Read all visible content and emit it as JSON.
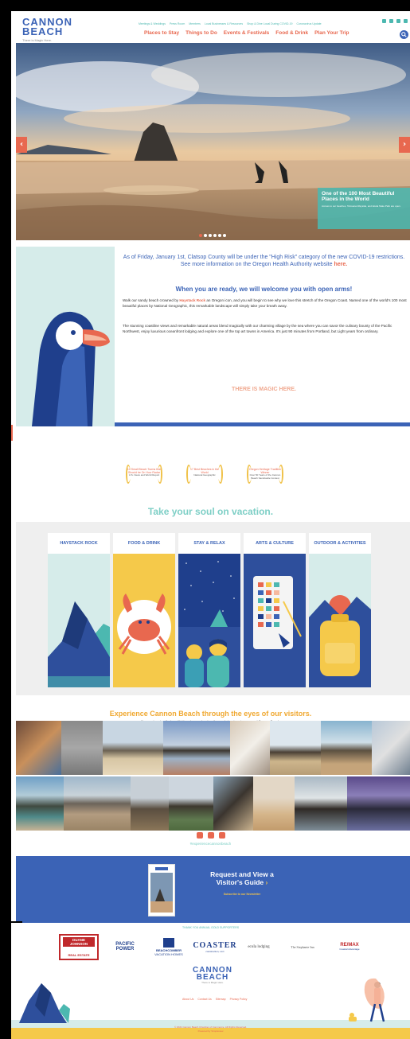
{
  "header": {
    "logo_line1": "CANNON",
    "logo_line2": "BEACH",
    "logo_tagline": "There is Magic Here.",
    "top_nav": [
      "Meetings & Weddings",
      "Press Room",
      "Members",
      "Local Businesses & Resources",
      "Shop & Dine Local During COVID-19",
      "Coronavirus Update"
    ],
    "main_nav": [
      "Places to Stay",
      "Things to Do",
      "Events & Festivals",
      "Food & Drink",
      "Plan Your Trip"
    ],
    "social_icons": [
      "facebook-icon",
      "instagram-icon",
      "youtube-icon",
      "share-icon"
    ]
  },
  "hero": {
    "caption_title": "One of the 100 Most Beautiful Places in the World",
    "caption_sub": "Access to our beaches, Tolovana Wayside, and Ecola State Park are open.",
    "prev": "‹",
    "next": "›",
    "slide_count": 6,
    "active_slide": 1
  },
  "intro": {
    "covid_text": "As of Friday, January 1st, Clatsop County will be under the \"High Risk\" category of the new COVID-19 restrictions. See more information on the Oregon Health Authority website",
    "covid_link": "here.",
    "welcome": "When you are ready, we will welcome you with open arms!",
    "p1_pre": "Walk our sandy beach crowned by",
    "p1_link": "Haystack Rock",
    "p1_post": "an Oregon icon, and you will begin to see why we love this stretch of the Oregon Coast. Named one of the world's 100 most beautiful places by National Geographic, this remarkable landscape will simply take your breath away.",
    "p2": "The stunning coastline views and remarkable natural areas blend magically with our charming village by the sea where you can savor the culinary bounty of the Pacific Northwest, enjoy luxurious oceanfront lodging and explore one of the top art towns in America. It's just 90 minutes from Portland, but Light years from ordinary.",
    "magic": "THERE IS MAGIC HERE."
  },
  "awards": [
    {
      "title": "10 Small Beach Towns that Should be On Your Radar",
      "source": "U.S. News and World Report"
    },
    {
      "title": "17 Best Beaches in the World",
      "source": "National Geographic"
    },
    {
      "title": "Oregon Heritage Tradition Winner",
      "source": "Over 50 Years of the Cannon Beach Sandcastle Contest"
    }
  ],
  "tagline": "Take your soul on vacation.",
  "categories": [
    "HAYSTACK ROCK",
    "FOOD & DRINK",
    "STAY & RELAX",
    "ARTS & CULTURE",
    "OUTDOOR & ACTIVITIES"
  ],
  "ugc": {
    "title": "Experience Cannon Beach through the eyes of our visitors.",
    "subtitle": "It's easy to enjoy the beautiful beaches, rocky shoreline and stunning views around Cannon Beach.",
    "hashtag": "#experiencecannonbeach"
  },
  "guide": {
    "title_line1": "Request and View a",
    "title_line2": "Visitor's Guide",
    "arrow": "›",
    "subscribe": "Subscribe to our Newsletter"
  },
  "sponsors": {
    "title": "THANK YOU ANNUAL GOLD SUPPORTERS",
    "items": [
      {
        "name": "DUANE JOHNSON",
        "sub": "REAL ESTATE"
      },
      {
        "name": "PACIFIC",
        "sub": "POWER"
      },
      {
        "name": "BEACHCOMBER",
        "sub": "VACATION HOMES"
      },
      {
        "name": "COASTER",
        "sub": "construction, LLC"
      },
      {
        "name": "ecoIa lodging",
        "sub": ""
      },
      {
        "name": "The Stephanie Inn",
        "sub": ""
      },
      {
        "name": "RE/MAX",
        "sub": "Coastal Advantage"
      }
    ]
  },
  "footer": {
    "logo_line1": "CANNON",
    "logo_line2": "BEACH",
    "logo_tagline": "There is Magic Here.",
    "links": [
      "About Us",
      "Contact Us",
      "Sitemap",
      "Privacy Policy"
    ],
    "copyright": "© 2021 Cannon Beach Chamber of Commerce. All Rights Reserved.",
    "powered_by": "Powered by Simpleview"
  },
  "colors": {
    "blue": "#3b63b6",
    "teal": "#4cb8b0",
    "coral": "#e8684f",
    "yellow": "#f0c24a"
  }
}
